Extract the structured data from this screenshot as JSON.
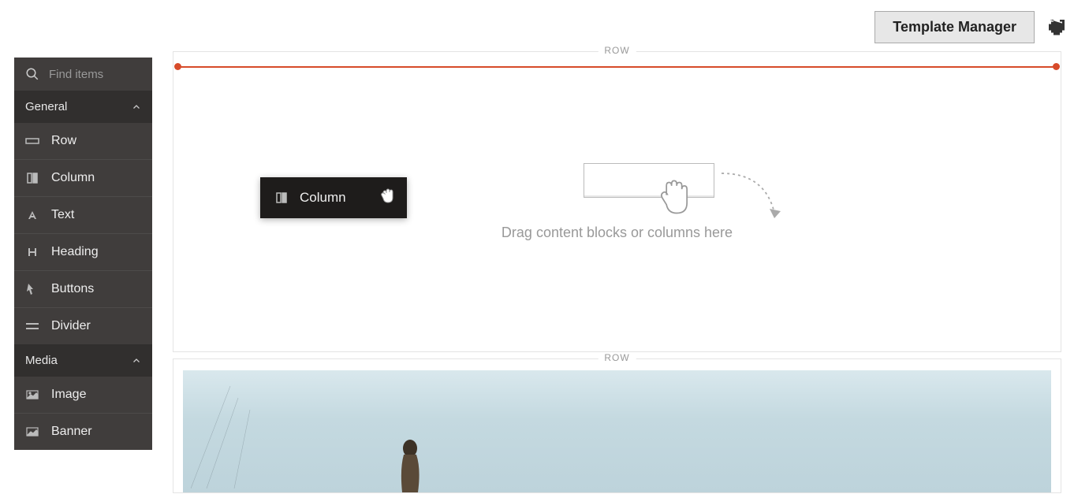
{
  "header": {
    "template_manager_label": "Template Manager"
  },
  "sidebar": {
    "search_placeholder": "Find items",
    "sections": [
      {
        "label": "General",
        "items": [
          {
            "label": "Row",
            "icon": "row-icon"
          },
          {
            "label": "Column",
            "icon": "column-icon"
          },
          {
            "label": "Text",
            "icon": "text-icon"
          },
          {
            "label": "Heading",
            "icon": "heading-icon"
          },
          {
            "label": "Buttons",
            "icon": "buttons-icon"
          },
          {
            "label": "Divider",
            "icon": "divider-icon"
          }
        ]
      },
      {
        "label": "Media",
        "items": [
          {
            "label": "Image",
            "icon": "image-icon"
          },
          {
            "label": "Banner",
            "icon": "banner-icon"
          }
        ]
      }
    ]
  },
  "canvas": {
    "row_label": "ROW",
    "drop_text": "Drag content blocks or columns here",
    "dragging_block_label": "Column"
  }
}
